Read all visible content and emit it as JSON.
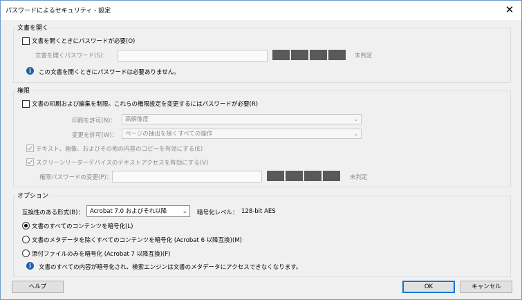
{
  "window": {
    "title": "パスワードによるセキュリティ - 設定",
    "close_glyph": "✕"
  },
  "open_doc": {
    "group_label": "文書を開く",
    "require_password_label": "文書を開くときにパスワードが必要(O)",
    "password_label": "文書を開くパスワード(S)：",
    "strength": "未判定",
    "info_text": "この文書を開くときにパスワードは必要ありません。"
  },
  "permissions": {
    "group_label": "権限",
    "restrict_label": "文書の印刷および編集を制限。これらの権限設定を変更するにはパスワードが必要(R)",
    "print_label": "印刷を許可(N)：",
    "print_value": "高解像度",
    "change_label": "変更を許可(W)：",
    "change_value": "ページの抽出を除くすべての操作",
    "copy_label": "テキスト、画像、およびその他の内容のコピーを有効にする(E)",
    "screenreader_label": "スクリーンリーダーデバイスのテキストアクセスを有効にする(V)",
    "perm_password_label": "権限パスワードの変更(P)：",
    "strength": "未判定"
  },
  "options": {
    "group_label": "オプション",
    "compat_label": "互換性のある形式(B)：",
    "compat_value": "Acrobat 7.0 およびそれ以降",
    "encryption_label": "暗号化レベル：",
    "encryption_value": "128-bit AES",
    "radios": [
      {
        "label": "文書のすべてのコンテンツを暗号化(L)",
        "selected": true
      },
      {
        "label": "文書のメタデータを除くすべてのコンテンツを暗号化 (Acrobat 6 以降互換)(M)",
        "selected": false
      },
      {
        "label": "添付ファイルのみを暗号化 (Acrobat 7 以降互換)(F)",
        "selected": false
      }
    ],
    "info_text": "文書のすべての内容が暗号化され、検索エンジンは文書のメタデータにアクセスできなくなります。"
  },
  "buttons": {
    "help": "ヘルプ",
    "ok": "OK",
    "cancel": "キャンセル"
  },
  "icons": {
    "info": "i",
    "dropdown": "⌄"
  }
}
